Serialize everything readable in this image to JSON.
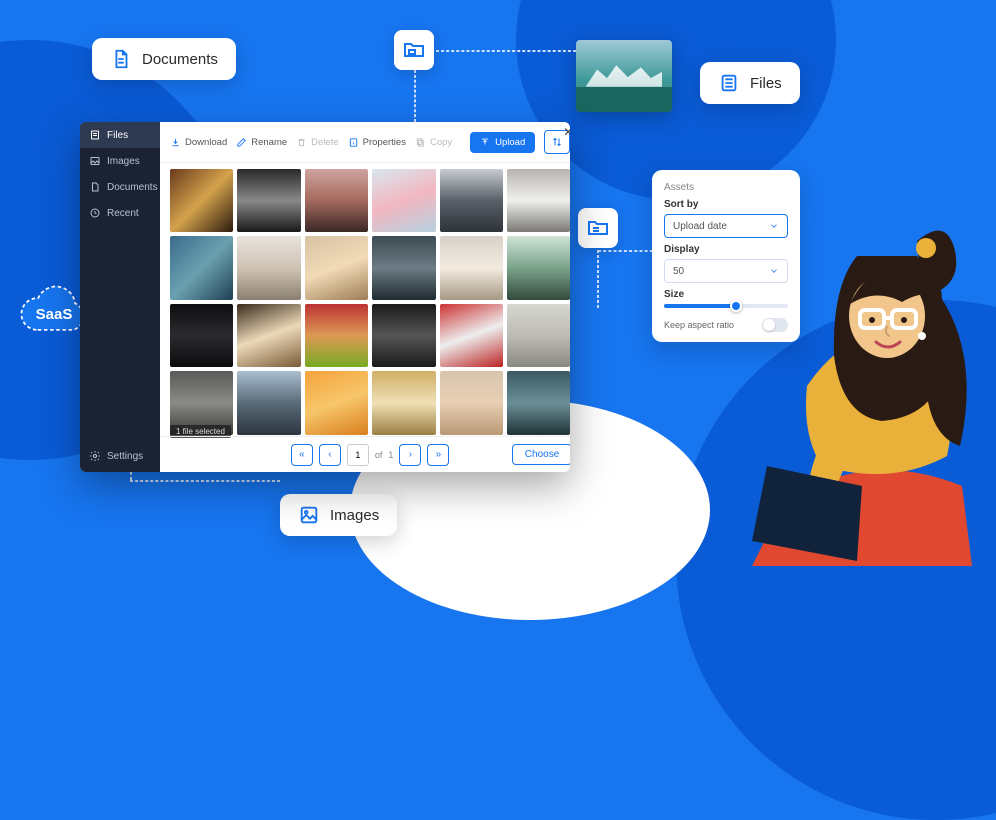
{
  "pills": {
    "documents": "Documents",
    "files": "Files",
    "images": "Images"
  },
  "saas_label": "SaaS",
  "file_manager": {
    "sidebar": {
      "items": [
        {
          "label": "Files"
        },
        {
          "label": "Images"
        },
        {
          "label": "Documents"
        },
        {
          "label": "Recent"
        }
      ],
      "settings": "Settings"
    },
    "toolbar": {
      "download": "Download",
      "rename": "Rename",
      "delete": "Delete",
      "properties": "Properties",
      "copy": "Copy",
      "upload": "Upload"
    },
    "grid": {
      "thumb_count": 24
    },
    "selection_strip": "1 file selected",
    "pager": {
      "current": "1",
      "of_label": "of",
      "total": "1"
    },
    "choose": "Choose"
  },
  "assets_panel": {
    "title": "Assets",
    "sort_label": "Sort by",
    "sort_value": "Upload date",
    "display_label": "Display",
    "display_value": "50",
    "size_label": "Size",
    "size_percent": 58,
    "keep_aspect": "Keep aspect ratio",
    "keep_aspect_on": false
  }
}
